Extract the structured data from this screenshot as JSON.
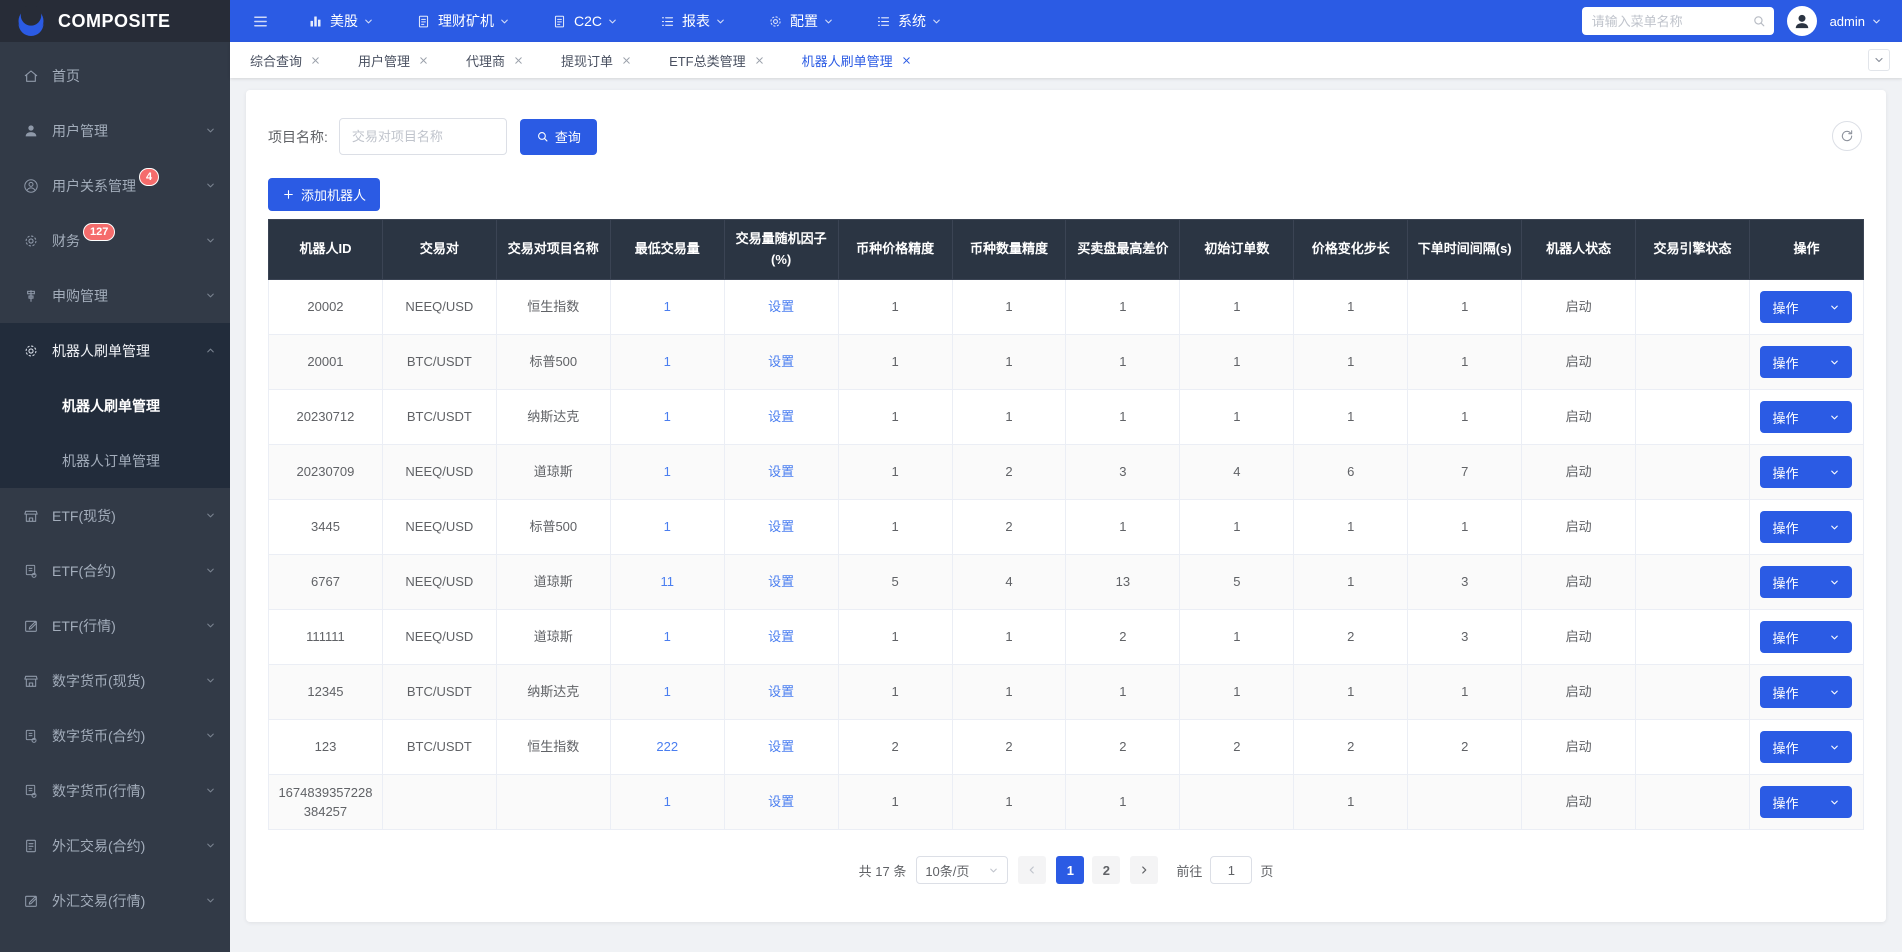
{
  "brand": {
    "name": "COMPOSITE"
  },
  "colors": {
    "accent": "#2b5be4",
    "link": "#4a7ef0",
    "badge": "#f56c6c",
    "table_header_bg": "#2b3543",
    "sidebar_bg": "#323a47"
  },
  "topnav": {
    "menus": [
      {
        "label": "美股",
        "icon": "chart"
      },
      {
        "label": "理财矿机",
        "icon": "doc"
      },
      {
        "label": "C2C",
        "icon": "doc"
      },
      {
        "label": "报表",
        "icon": "list"
      },
      {
        "label": "配置",
        "icon": "gear"
      },
      {
        "label": "系统",
        "icon": "list"
      }
    ],
    "search_placeholder": "请输入菜单名称",
    "user": "admin"
  },
  "sidebar": {
    "items": [
      {
        "label": "首页",
        "icon": "home",
        "expandable": false
      },
      {
        "label": "用户管理",
        "icon": "user",
        "expandable": true
      },
      {
        "label": "用户关系管理",
        "icon": "user-circle",
        "badge": "4",
        "expandable": true
      },
      {
        "label": "财务",
        "icon": "gear",
        "badge": "127",
        "expandable": true
      },
      {
        "label": "申购管理",
        "icon": "subscribe",
        "expandable": true
      },
      {
        "label": "机器人刷单管理",
        "icon": "gear",
        "expandable": true,
        "active": true,
        "expanded": true,
        "children": [
          {
            "label": "机器人刷单管理",
            "active": true
          },
          {
            "label": "机器人订单管理",
            "active": false
          }
        ]
      },
      {
        "label": "ETF(现货)",
        "icon": "shop",
        "expandable": true
      },
      {
        "label": "ETF(合约)",
        "icon": "sql",
        "expandable": true
      },
      {
        "label": "ETF(行情)",
        "icon": "edit",
        "expandable": true
      },
      {
        "label": "数字货币(现货)",
        "icon": "shop",
        "expandable": true
      },
      {
        "label": "数字货币(合约)",
        "icon": "sql",
        "expandable": true
      },
      {
        "label": "数字货币(行情)",
        "icon": "sql",
        "expandable": true
      },
      {
        "label": "外汇交易(合约)",
        "icon": "doc",
        "expandable": true
      },
      {
        "label": "外汇交易(行情)",
        "icon": "edit",
        "expandable": true
      }
    ]
  },
  "tabs": [
    {
      "label": "综合查询",
      "active": false
    },
    {
      "label": "用户管理",
      "active": false
    },
    {
      "label": "代理商",
      "active": false
    },
    {
      "label": "提现订单",
      "active": false
    },
    {
      "label": "ETF总类管理",
      "active": false
    },
    {
      "label": "机器人刷单管理",
      "active": true
    }
  ],
  "filter": {
    "label": "项目名称:",
    "placeholder": "交易对项目名称",
    "search_button": "查询"
  },
  "toolbar": {
    "add_button": "添加机器人"
  },
  "table": {
    "headers": [
      "机器人ID",
      "交易对",
      "交易对项目名称",
      "最低交易量",
      "交易量随机因子(%)",
      "币种价格精度",
      "币种数量精度",
      "买卖盘最高差价",
      "初始订单数",
      "价格变化步长",
      "下单时间间隔(s)",
      "机器人状态",
      "交易引擎状态",
      "操作"
    ],
    "set_link": "设置",
    "action_button": "操作",
    "rows": [
      {
        "id": "20002",
        "pair": "NEEQ/USD",
        "project": "恒生指数",
        "min_volume": "1",
        "price_precision": "1",
        "qty_precision": "1",
        "max_spread": "1",
        "initial_orders": "1",
        "price_step": "1",
        "interval": "1",
        "robot_status": "启动",
        "engine_status": ""
      },
      {
        "id": "20001",
        "pair": "BTC/USDT",
        "project": "标普500",
        "min_volume": "1",
        "price_precision": "1",
        "qty_precision": "1",
        "max_spread": "1",
        "initial_orders": "1",
        "price_step": "1",
        "interval": "1",
        "robot_status": "启动",
        "engine_status": ""
      },
      {
        "id": "20230712",
        "pair": "BTC/USDT",
        "project": "纳斯达克",
        "min_volume": "1",
        "price_precision": "1",
        "qty_precision": "1",
        "max_spread": "1",
        "initial_orders": "1",
        "price_step": "1",
        "interval": "1",
        "robot_status": "启动",
        "engine_status": ""
      },
      {
        "id": "20230709",
        "pair": "NEEQ/USD",
        "project": "道琼斯",
        "min_volume": "1",
        "price_precision": "1",
        "qty_precision": "2",
        "max_spread": "3",
        "initial_orders": "4",
        "price_step": "6",
        "interval": "7",
        "robot_status": "启动",
        "engine_status": ""
      },
      {
        "id": "3445",
        "pair": "NEEQ/USD",
        "project": "标普500",
        "min_volume": "1",
        "price_precision": "1",
        "qty_precision": "2",
        "max_spread": "1",
        "initial_orders": "1",
        "price_step": "1",
        "interval": "1",
        "robot_status": "启动",
        "engine_status": ""
      },
      {
        "id": "6767",
        "pair": "NEEQ/USD",
        "project": "道琼斯",
        "min_volume": "11",
        "price_precision": "5",
        "qty_precision": "4",
        "max_spread": "13",
        "initial_orders": "5",
        "price_step": "1",
        "interval": "3",
        "robot_status": "启动",
        "engine_status": ""
      },
      {
        "id": "111111",
        "pair": "NEEQ/USD",
        "project": "道琼斯",
        "min_volume": "1",
        "price_precision": "1",
        "qty_precision": "1",
        "max_spread": "2",
        "initial_orders": "1",
        "price_step": "2",
        "interval": "3",
        "robot_status": "启动",
        "engine_status": ""
      },
      {
        "id": "12345",
        "pair": "BTC/USDT",
        "project": "纳斯达克",
        "min_volume": "1",
        "price_precision": "1",
        "qty_precision": "1",
        "max_spread": "1",
        "initial_orders": "1",
        "price_step": "1",
        "interval": "1",
        "robot_status": "启动",
        "engine_status": ""
      },
      {
        "id": "123",
        "pair": "BTC/USDT",
        "project": "恒生指数",
        "min_volume": "222",
        "price_precision": "2",
        "qty_precision": "2",
        "max_spread": "2",
        "initial_orders": "2",
        "price_step": "2",
        "interval": "2",
        "robot_status": "启动",
        "engine_status": ""
      },
      {
        "id": "1674839357228384257",
        "pair": "",
        "project": "",
        "min_volume": "1",
        "price_precision": "1",
        "qty_precision": "1",
        "max_spread": "1",
        "initial_orders": "",
        "price_step": "1",
        "interval": "",
        "robot_status": "启动",
        "engine_status": ""
      }
    ]
  },
  "pagination": {
    "total": "共 17 条",
    "page_size": "10条/页",
    "pages": [
      "1",
      "2"
    ],
    "current": "1",
    "goto_label": "前往",
    "goto_value": "1",
    "goto_suffix": "页"
  }
}
